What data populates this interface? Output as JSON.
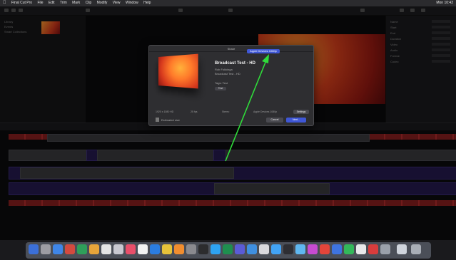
{
  "menubar": {
    "items": [
      "Final Cut Pro",
      "File",
      "Edit",
      "Trim",
      "Mark",
      "Clip",
      "Modify",
      "View",
      "Window",
      "Help"
    ],
    "right": "Mon 10:42"
  },
  "modal": {
    "title": "Share",
    "tab": "Apple Devices 1080p",
    "project_name": "Broadcast Test - HD",
    "info": [
      "Rob Fokkinga",
      "Broadcast Test - HD",
      "Tags: Test"
    ],
    "tag": "Test",
    "formats": [
      "1920 x 1080 HD",
      "25 fps",
      "Stereo",
      "Apple Devices 1080p"
    ],
    "mini_button": "Settings",
    "footer_label": "Estimated size",
    "cancel": "Cancel",
    "next": "Next..."
  },
  "inspector": {
    "rows": [
      "Name",
      "Start",
      "End",
      "Duration",
      "Video",
      "Audio",
      "Format",
      "Codec"
    ]
  },
  "library": {
    "items": [
      "Library",
      "Events",
      "Smart Collections"
    ]
  },
  "colors": {
    "accent": "#3f57d6",
    "arrow": "#2fdc3a",
    "clip_red": "#8a1f1f",
    "clip_blue": "#261a4f"
  }
}
